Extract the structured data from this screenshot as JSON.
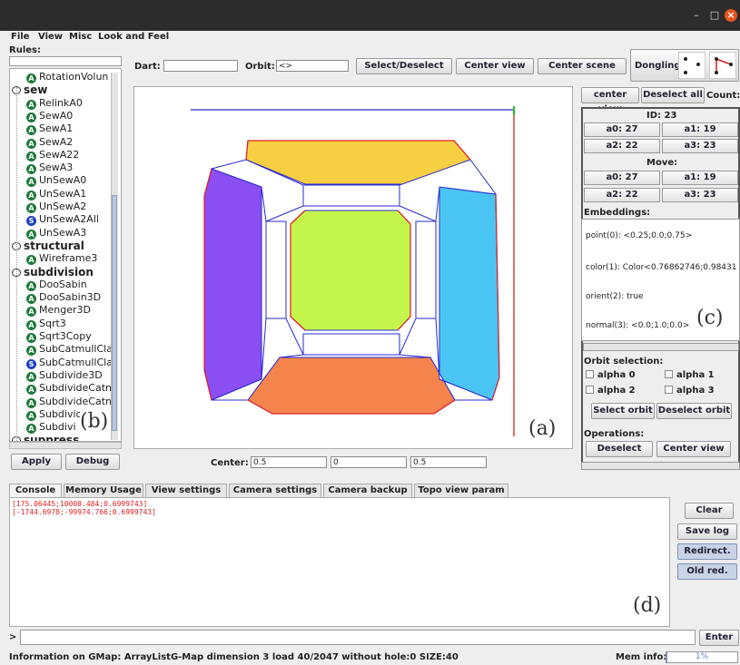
{
  "menu": {
    "file": "File",
    "view": "View",
    "misc": "Misc",
    "look": "Look and Feel"
  },
  "rules": {
    "label": "Rules:",
    "items": [
      {
        "kind": "rule",
        "icon": "A",
        "label": "RotationVolun"
      },
      {
        "kind": "cat",
        "label": "sew"
      },
      {
        "kind": "rule",
        "icon": "A",
        "label": "RelinkA0"
      },
      {
        "kind": "rule",
        "icon": "A",
        "label": "SewA0"
      },
      {
        "kind": "rule",
        "icon": "A",
        "label": "SewA1"
      },
      {
        "kind": "rule",
        "icon": "A",
        "label": "SewA2"
      },
      {
        "kind": "rule",
        "icon": "A",
        "label": "SewA22"
      },
      {
        "kind": "rule",
        "icon": "A",
        "label": "SewA3"
      },
      {
        "kind": "rule",
        "icon": "A",
        "label": "UnSewA0"
      },
      {
        "kind": "rule",
        "icon": "A",
        "label": "UnSewA1"
      },
      {
        "kind": "rule",
        "icon": "A",
        "label": "UnSewA2"
      },
      {
        "kind": "rule",
        "icon": "S",
        "label": "UnSewA2All"
      },
      {
        "kind": "rule",
        "icon": "A",
        "label": "UnSewA3"
      },
      {
        "kind": "cat",
        "label": "structural"
      },
      {
        "kind": "rule",
        "icon": "A",
        "label": "Wireframe3"
      },
      {
        "kind": "cat",
        "label": "subdivision"
      },
      {
        "kind": "rule",
        "icon": "A",
        "label": "DooSabin"
      },
      {
        "kind": "rule",
        "icon": "A",
        "label": "DooSabin3D"
      },
      {
        "kind": "rule",
        "icon": "A",
        "label": "Menger3D"
      },
      {
        "kind": "rule",
        "icon": "A",
        "label": "Sqrt3"
      },
      {
        "kind": "rule",
        "icon": "A",
        "label": "Sqrt3Copy"
      },
      {
        "kind": "rule",
        "icon": "A",
        "label": "SubCatmullCla"
      },
      {
        "kind": "rule",
        "icon": "S",
        "label": "SubCatmullCla"
      },
      {
        "kind": "rule",
        "icon": "A",
        "label": "Subdivide3D"
      },
      {
        "kind": "rule",
        "icon": "A",
        "label": "SubdivideCatn"
      },
      {
        "kind": "rule",
        "icon": "A",
        "label": "SubdivideCatn"
      },
      {
        "kind": "rule",
        "icon": "A",
        "label": "Subdivic"
      },
      {
        "kind": "rule",
        "icon": "A",
        "label": "Subdivi"
      },
      {
        "kind": "cat",
        "label": "suppress"
      }
    ],
    "apply": "Apply",
    "debug": "Debug"
  },
  "toolbar": {
    "dart_label": "Dart:",
    "dart_value": "",
    "orbit_label": "Orbit:",
    "orbit_value": "<>",
    "select_deselect": "Select/Deselect",
    "center_view": "Center view",
    "center_scene": "Center scene",
    "dongling_label": "Dongling:"
  },
  "center": {
    "label": "Center:",
    "x": "0.5",
    "y": "0",
    "z": "0.5"
  },
  "panel": {
    "center_view": "center view",
    "deselect_all": "Deselect all",
    "count": "Count:",
    "id_label": "ID: 23",
    "a0": "a0: 27",
    "a1": "a1: 19",
    "a2": "a2: 22",
    "a3": "a3: 23",
    "move_label": "Move:",
    "m_a0": "a0: 27",
    "m_a1": "a1: 19",
    "m_a2": "a2: 22",
    "m_a3": "a3: 23",
    "embeddings_label": "Embeddings:",
    "emb_point": "point(0): <0.25;0.0;0.75>",
    "emb_color": "color(1): Color<0.76862746;0.98431",
    "emb_orient": "orient(2): true",
    "emb_normal": "normal(3): <0.0;1.0;0.0>",
    "orbit_selection": "Orbit selection:",
    "alpha0": "alpha 0",
    "alpha1": "alpha 1",
    "alpha2": "alpha 2",
    "alpha3": "alpha 3",
    "select_orbit": "Select orbit",
    "deselect_orbit": "Deselect orbit",
    "operations": "Operations:",
    "deselect": "Deselect",
    "op_center_view": "Center view"
  },
  "tabs": [
    "Console",
    "Memory Usage",
    "View settings",
    "Camera settings",
    "Camera backup",
    "Topo view param"
  ],
  "console": {
    "lines": [
      "[175.06445;10008.484;0.6999743]",
      "[-1744.6978;-99974.766;0.6999743]"
    ],
    "clear": "Clear",
    "save_log": "Save log",
    "redirect": "Redirect.",
    "old_red": "Old red.",
    "prompt": ">",
    "enter": "Enter"
  },
  "status": {
    "info": "Information on GMap:  ArrayListG-Map dimension 3 load 40/2047 without hole:0 SIZE:40",
    "mem_label": "Mem info:",
    "mem_value": "1%",
    "mem_fraction": 0.01
  },
  "annotations": {
    "a": "(a)",
    "b": "(b)",
    "c": "(c)",
    "d": "(d)"
  },
  "colors": {
    "yellow": "#f7cf42",
    "green": "#c4f54a",
    "orange": "#f5844c",
    "purple": "#8b4ef2",
    "cyan": "#4ac4f2",
    "edge_blue": "#2a2ad0",
    "edge_red": "#e02020"
  }
}
